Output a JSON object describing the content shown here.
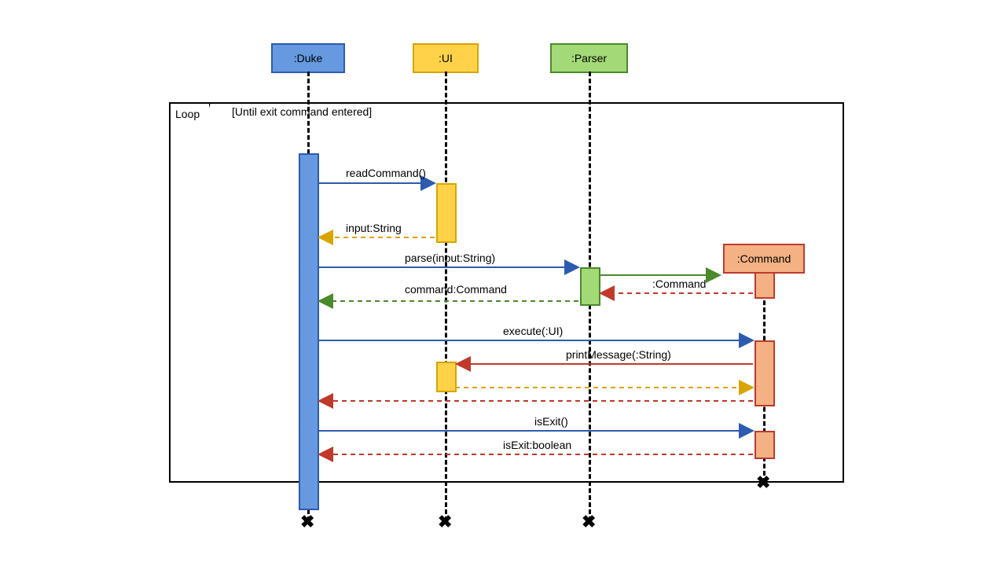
{
  "participants": {
    "duke": ":Duke",
    "ui": ":UI",
    "parser": ":Parser",
    "command": ":Command"
  },
  "frame": {
    "label": "Loop",
    "guard": "[Until exit command entered]"
  },
  "messages": {
    "readCommand": "readCommand()",
    "inputString": "input:String",
    "parse": "parse(input:String)",
    "commandReturn": "command:Command",
    "create": ":Command",
    "execute": "execute(:UI)",
    "print": "printMessage(:String)",
    "isExit": "isExit()",
    "isExitRet": "isExit:boolean"
  },
  "colors": {
    "dukeFill": "#6699e0",
    "dukeStroke": "#2d5bb0",
    "uiFill": "#ffd24a",
    "uiStroke": "#d9a400",
    "parserFill": "#a3d977",
    "parserStroke": "#4a8a2a",
    "cmdFill": "#f4b183",
    "cmdStroke": "#c0392b",
    "redStroke": "#c0392b"
  }
}
